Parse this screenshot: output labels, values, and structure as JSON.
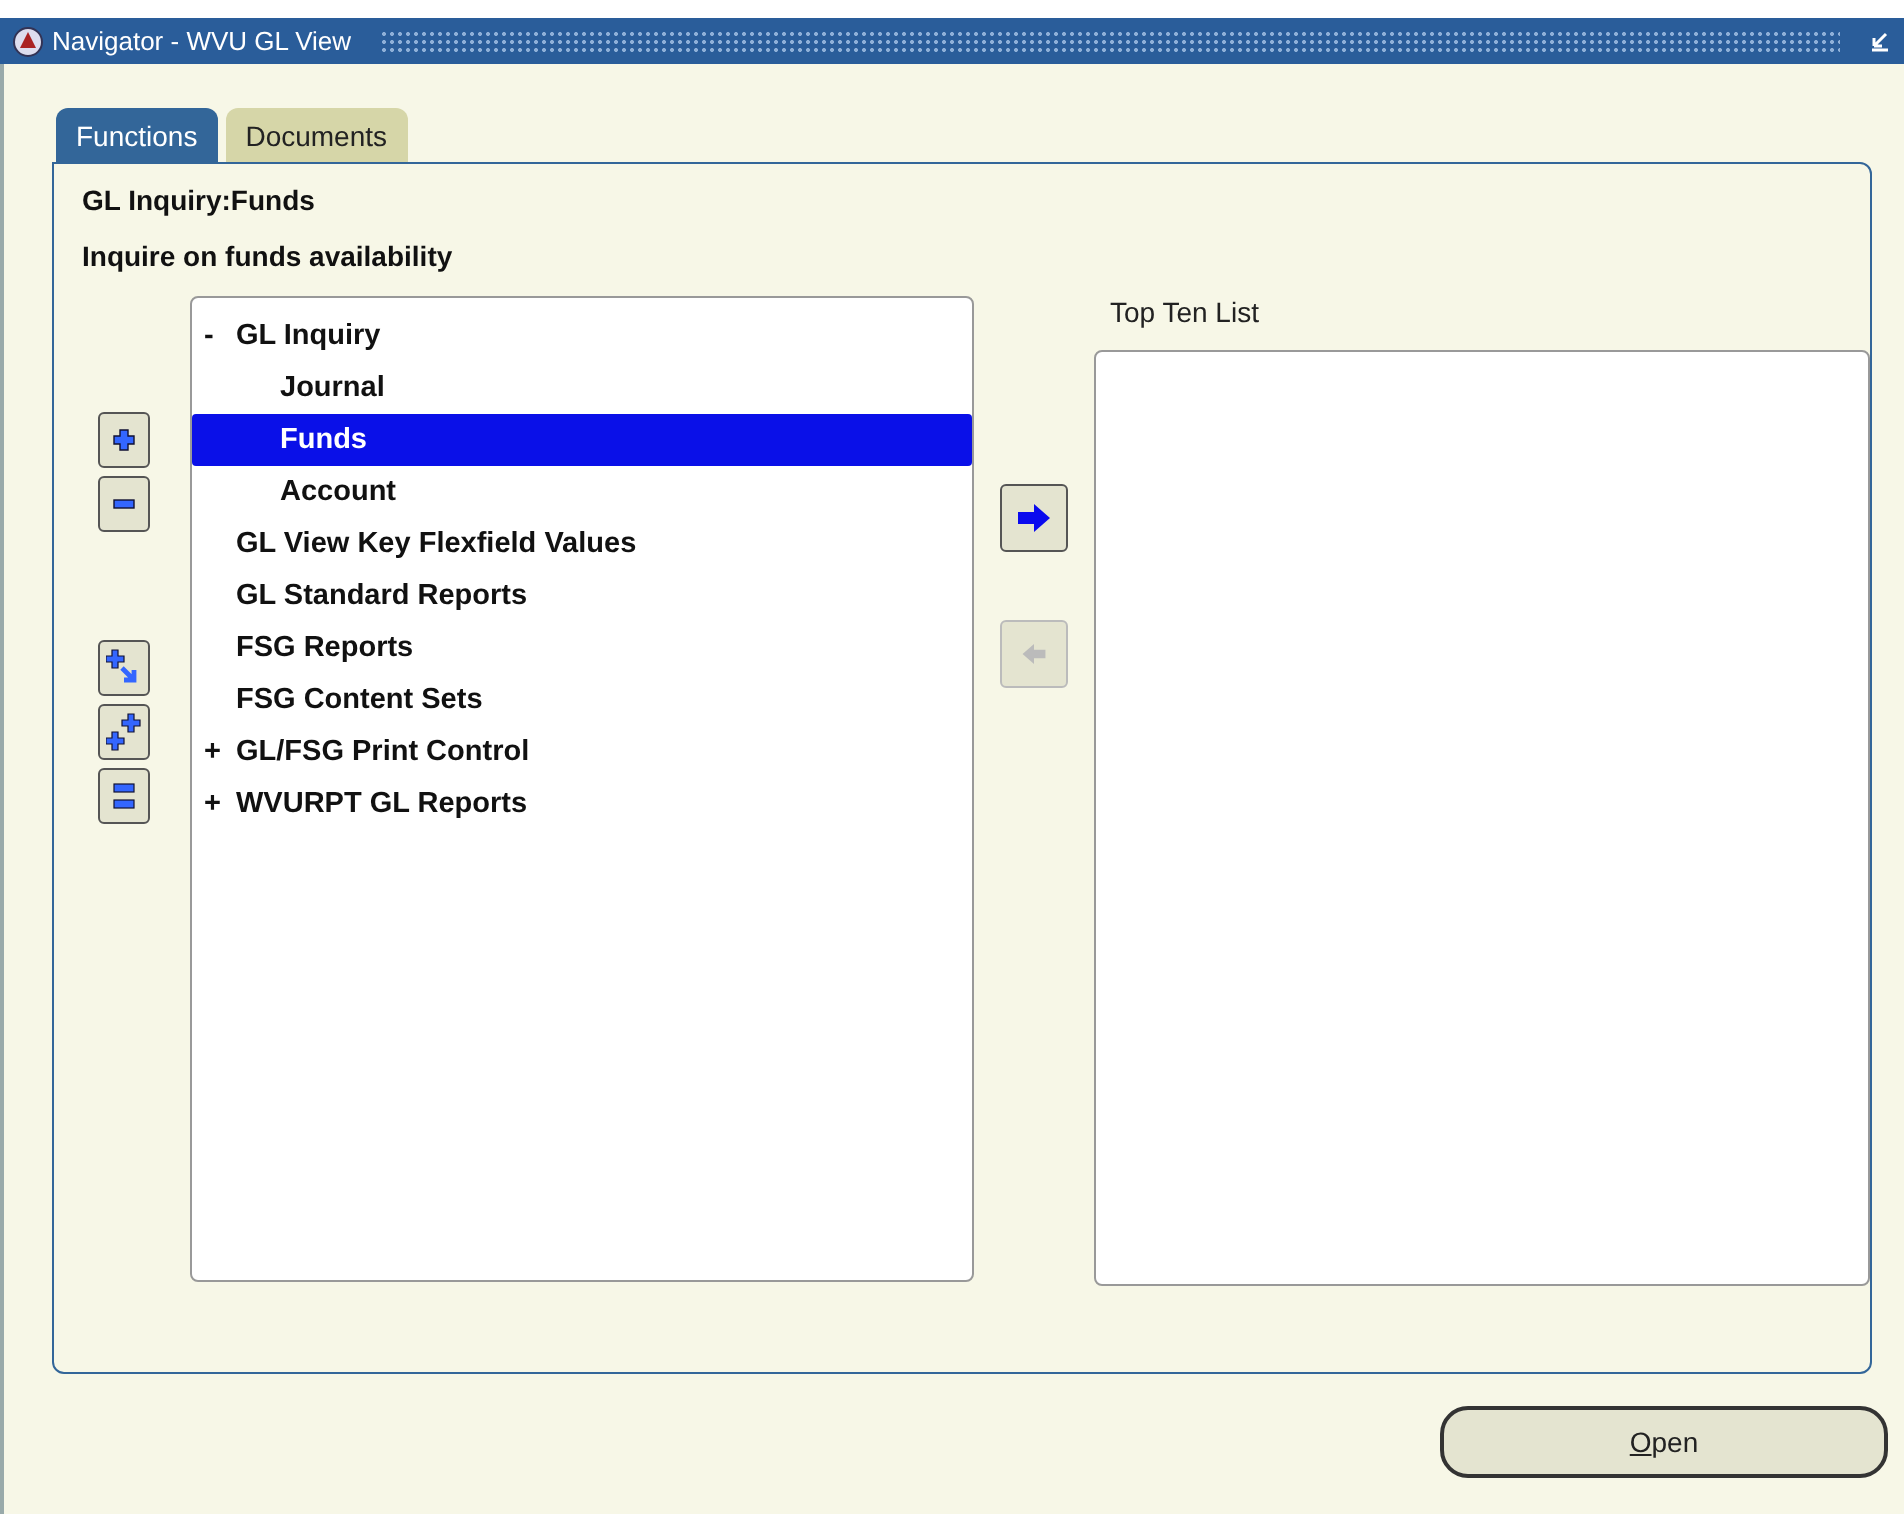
{
  "window": {
    "title": "Navigator - WVU GL View"
  },
  "tabs": [
    {
      "label": "Functions",
      "selected": true
    },
    {
      "label": "Documents",
      "selected": false
    }
  ],
  "heading": "GL Inquiry:Funds",
  "description": "Inquire on funds availability",
  "tree": {
    "items": [
      {
        "marker": "-",
        "label": "GL Inquiry",
        "selected": false,
        "children": [
          {
            "label": "Journal",
            "selected": false
          },
          {
            "label": "Funds",
            "selected": true
          },
          {
            "label": "Account",
            "selected": false
          }
        ]
      },
      {
        "label": "GL View Key Flexfield Values",
        "selected": false
      },
      {
        "label": "GL Standard Reports",
        "selected": false
      },
      {
        "label": "FSG Reports",
        "selected": false
      },
      {
        "label": "FSG Content Sets",
        "selected": false
      },
      {
        "marker": "+",
        "label": "GL/FSG Print Control",
        "selected": false
      },
      {
        "marker": "+",
        "label": "WVURPT GL Reports",
        "selected": false
      }
    ]
  },
  "tree_buttons": [
    {
      "kind": "expand"
    },
    {
      "kind": "collapse"
    },
    {
      "kind": "expand-branch"
    },
    {
      "kind": "expand-all"
    },
    {
      "kind": "collapse-all"
    }
  ],
  "move_buttons": [
    {
      "kind": "add",
      "disabled": false
    },
    {
      "kind": "remove",
      "disabled": true
    }
  ],
  "top_ten": {
    "label": "Top Ten List"
  },
  "open_button": {
    "label": "Open"
  }
}
